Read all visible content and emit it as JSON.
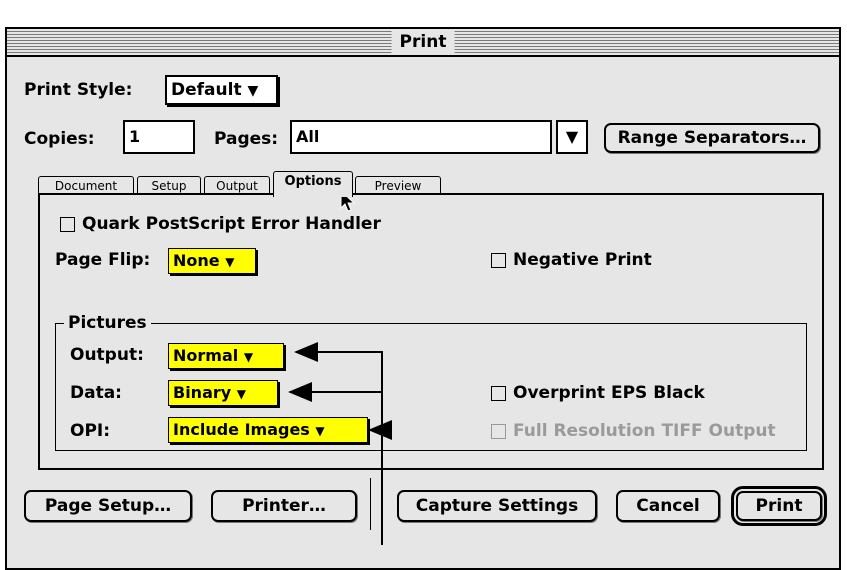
{
  "window": {
    "title": "Print"
  },
  "print_style": {
    "label": "Print Style:",
    "value": "Default"
  },
  "copies": {
    "label": "Copies:",
    "value": "1"
  },
  "pages": {
    "label": "Pages:",
    "value": "All"
  },
  "range_separators_label": "Range Separators…",
  "tabs": [
    {
      "label": "Document",
      "active": false
    },
    {
      "label": "Setup",
      "active": false
    },
    {
      "label": "Output",
      "active": false
    },
    {
      "label": "Options",
      "active": true
    },
    {
      "label": "Preview",
      "active": false
    }
  ],
  "options": {
    "error_handler_label": "Quark PostScript Error Handler",
    "error_handler_checked": false,
    "page_flip": {
      "label": "Page Flip:",
      "value": "None"
    },
    "negative_print": {
      "label": "Negative Print",
      "checked": false
    }
  },
  "pictures": {
    "title": "Pictures",
    "output": {
      "label": "Output:",
      "value": "Normal"
    },
    "data": {
      "label": "Data:",
      "value": "Binary"
    },
    "opi": {
      "label": "OPI:",
      "value": "Include Images"
    },
    "overprint_eps_black": {
      "label": "Overprint EPS Black",
      "checked": false
    },
    "full_res_tiff": {
      "label": "Full Resolution TIFF Output",
      "checked": false,
      "enabled": false
    }
  },
  "buttons": {
    "page_setup": "Page Setup…",
    "printer": "Printer…",
    "capture_settings": "Capture Settings",
    "cancel": "Cancel",
    "print": "Print"
  },
  "icons": {
    "dropdown": "triangle-down-icon",
    "cursor": "arrow-cursor-icon"
  },
  "colors": {
    "highlight": "#ffff00",
    "window_bg": "#e6e6e6"
  }
}
